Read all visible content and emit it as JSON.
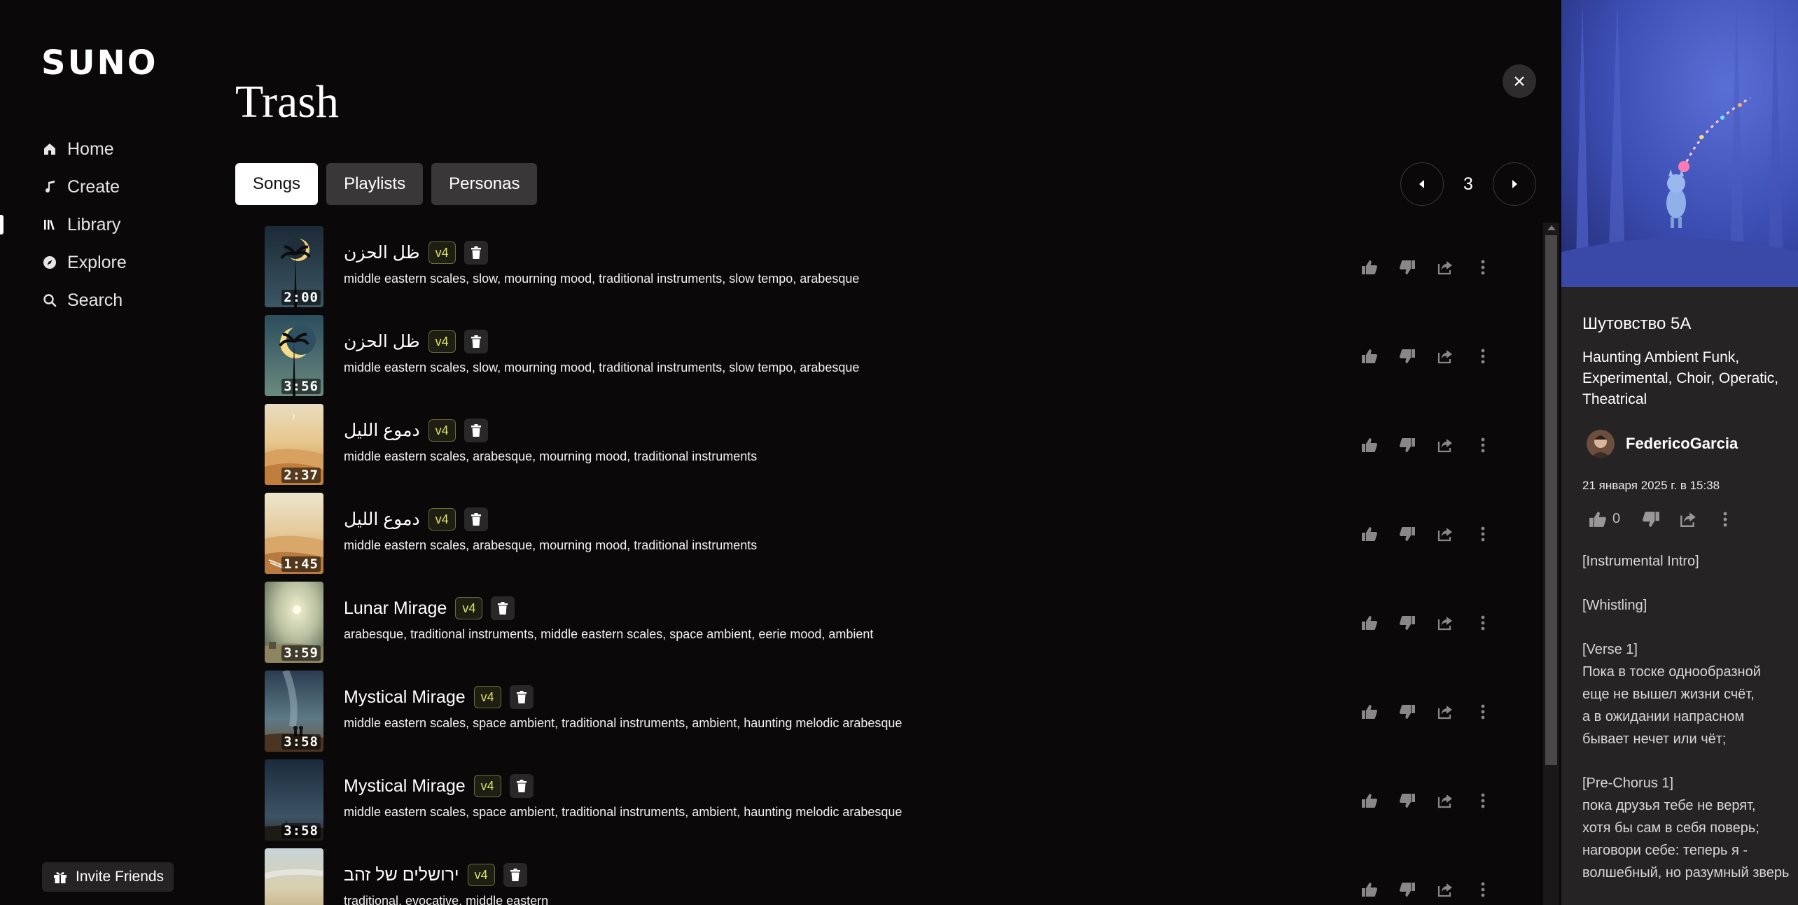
{
  "app": {
    "logo": "SUNO"
  },
  "sidebar": {
    "items": [
      {
        "label": "Home",
        "icon": "home-icon"
      },
      {
        "label": "Create",
        "icon": "music-note-icon"
      },
      {
        "label": "Library",
        "icon": "library-icon",
        "active": true
      },
      {
        "label": "Explore",
        "icon": "compass-icon"
      },
      {
        "label": "Search",
        "icon": "search-icon"
      }
    ],
    "invite_label": "Invite Friends"
  },
  "main": {
    "title": "Trash",
    "tabs": [
      {
        "label": "Songs",
        "active": true
      },
      {
        "label": "Playlists"
      },
      {
        "label": "Personas"
      }
    ],
    "pager": {
      "page": "3"
    },
    "songs": [
      {
        "title": "ظل الحزن",
        "badge": "v4",
        "duration": "2:00",
        "tags": "middle eastern scales, slow, mourning mood, traditional instruments, slow tempo, arabesque"
      },
      {
        "title": "ظل الحزن",
        "badge": "v4",
        "duration": "3:56",
        "tags": "middle eastern scales, slow, mourning mood, traditional instruments, slow tempo, arabesque"
      },
      {
        "title": "دموع الليل",
        "badge": "v4",
        "duration": "2:37",
        "tags": "middle eastern scales, arabesque, mourning mood, traditional instruments"
      },
      {
        "title": "دموع الليل",
        "badge": "v4",
        "duration": "1:45",
        "tags": "middle eastern scales, arabesque, mourning mood, traditional instruments"
      },
      {
        "title": "Lunar Mirage",
        "badge": "v4",
        "duration": "3:59",
        "tags": "arabesque, traditional instruments, middle eastern scales, space ambient, eerie mood, ambient"
      },
      {
        "title": "Mystical Mirage",
        "badge": "v4",
        "duration": "3:58",
        "tags": "middle eastern scales, space ambient, traditional instruments, ambient, haunting melodic arabesque"
      },
      {
        "title": "Mystical Mirage",
        "badge": "v4",
        "duration": "3:58",
        "tags": "middle eastern scales, space ambient, traditional instruments, ambient, haunting melodic arabesque"
      },
      {
        "title": "ירושלים של זהב",
        "badge": "v4",
        "duration": "",
        "tags": "traditional, evocative, middle eastern"
      }
    ]
  },
  "panel": {
    "title": "Шутовство 5А",
    "styles": "Haunting Ambient Funk, Experimental, Choir, Operatic, Theatrical",
    "username": "FedericoGarcia",
    "date": "21 января 2025 г. в 15:38",
    "likes": "0",
    "lyrics": [
      "[Instrumental Intro]",
      "",
      "[Whistling]",
      "",
      "[Verse 1]",
      "Пока в тоске однообразной",
      "еще не вышел жизни счёт,",
      "а в ожидании напрасном",
      "бывает нечет или чёт;",
      "",
      "[Pre-Chorus 1]",
      "пока друзья тебе не верят,",
      "хотя бы сам в себя поверь;",
      "наговори себе: теперь я -",
      "волшебный, но разумный зверь"
    ]
  },
  "colors": {
    "background": "#0b0809",
    "panel": "#262324",
    "badge_text": "#d8e36a",
    "tab_active": "#ffffff"
  }
}
